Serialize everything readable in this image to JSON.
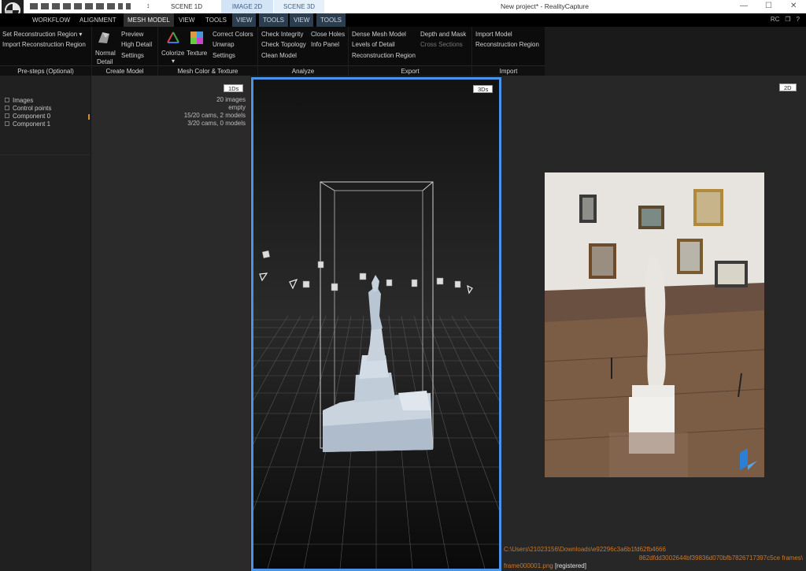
{
  "titlebar": {
    "window_title": "New project* - RealityCapture",
    "scene_tabs": [
      "SCENE 1D",
      "IMAGE 2D",
      "SCENE 3D"
    ],
    "pin_glyph": "↕",
    "controls": {
      "minimize": "—",
      "maximize": "☐",
      "close": "✕"
    }
  },
  "menubar": {
    "items": [
      "WORKFLOW",
      "ALIGNMENT",
      "MESH MODEL",
      "VIEW",
      "TOOLS",
      "VIEW",
      "TOOLS",
      "VIEW",
      "TOOLS"
    ],
    "right": [
      "RC",
      "❐",
      "?"
    ]
  },
  "ribbon": {
    "presteps": {
      "label": "Pre-steps (Optional)",
      "items": [
        "Set Reconstruction Region",
        "Import Reconstruction Region"
      ]
    },
    "create_model": {
      "label": "Create Model",
      "normal_detail": [
        "Normal",
        "Detail"
      ],
      "items": [
        "Preview",
        "High Detail",
        "Settings"
      ]
    },
    "mesh_color": {
      "label": "Mesh Color & Texture",
      "colorize": "Colorize",
      "texture": "Texture",
      "items": [
        "Correct Colors",
        "Unwrap",
        "Settings"
      ]
    },
    "analyze": {
      "label": "Analyze",
      "col1": [
        "Check Integrity",
        "Check Topology",
        "Clean Model"
      ],
      "col2": [
        "Close Holes",
        "Info Panel"
      ]
    },
    "export": {
      "label": "Export",
      "col1": [
        "Dense Mesh Model",
        "Levels of Detail",
        "Reconstruction Region"
      ],
      "col2": [
        "Depth and Mask",
        "Cross Sections"
      ]
    },
    "import": {
      "label": "Import",
      "items": [
        "Import Model",
        "Reconstruction Region"
      ]
    }
  },
  "tree": {
    "items": [
      "Images",
      "Control points",
      "Component 0",
      "Component 1"
    ]
  },
  "panel1d": {
    "label": "1Ds",
    "info": [
      "20 images",
      "empty",
      "15/20 cams, 2 models",
      "3/20 cams, 0 models"
    ]
  },
  "panel3d": {
    "label": "3Ds"
  },
  "panel2d": {
    "label": "2D",
    "path_line1": "C:\\Users\\21023156\\Downloads\\e92296c3a6b1fd62fb4666",
    "path_line2": "862dfdd3002644bf39836d070bfb7826717397c5ce frames\\",
    "frame_file": "frame000001.png",
    "frame_status": "[registered]"
  },
  "colors": {
    "accent_blue": "#4b93e6",
    "path_orange": "#c8782e",
    "marker_orange": "#d98b2a"
  }
}
